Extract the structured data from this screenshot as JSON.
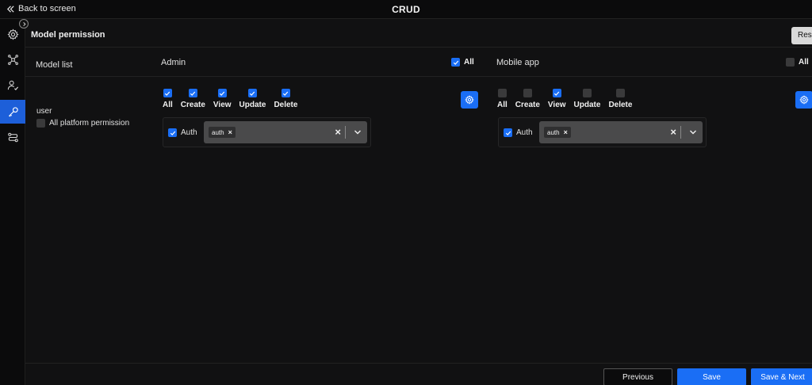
{
  "header": {
    "back_label": "Back to screen",
    "title": "CRUD"
  },
  "sidebar": {
    "items": [
      {
        "icon": "settings-gear-icon"
      },
      {
        "icon": "ai-network-icon"
      },
      {
        "icon": "user-check-icon"
      },
      {
        "icon": "key-icon",
        "active": true
      },
      {
        "icon": "flow-icon"
      }
    ]
  },
  "main": {
    "title": "Model permission",
    "reset_label": "Reset",
    "model_list_label": "Model list",
    "model": {
      "name": "user",
      "all_platform_label": "All platform permission",
      "all_platform_checked": false
    },
    "platforms": [
      {
        "name": "Admin",
        "all_label": "All",
        "all_checked": true,
        "permissions": [
          {
            "label": "All",
            "checked": true
          },
          {
            "label": "Create",
            "checked": true
          },
          {
            "label": "View",
            "checked": true
          },
          {
            "label": "Update",
            "checked": true
          },
          {
            "label": "Delete",
            "checked": true
          }
        ],
        "auth_label": "Auth",
        "auth_checked": true,
        "selected_chip": "auth",
        "chip_remove": "×",
        "clear_symbol": "×"
      },
      {
        "name": "Mobile app",
        "all_label": "All",
        "all_checked": false,
        "permissions": [
          {
            "label": "All",
            "checked": false
          },
          {
            "label": "Create",
            "checked": false
          },
          {
            "label": "View",
            "checked": true
          },
          {
            "label": "Update",
            "checked": false
          },
          {
            "label": "Delete",
            "checked": false
          }
        ],
        "auth_label": "Auth",
        "auth_checked": true,
        "selected_chip": "auth",
        "chip_remove": "×",
        "clear_symbol": "×"
      }
    ]
  },
  "footer": {
    "previous_label": "Previous",
    "save_label": "Save",
    "save_next_label": "Save & Next"
  },
  "colors": {
    "accent": "#1a6ef5",
    "background": "#111112"
  }
}
